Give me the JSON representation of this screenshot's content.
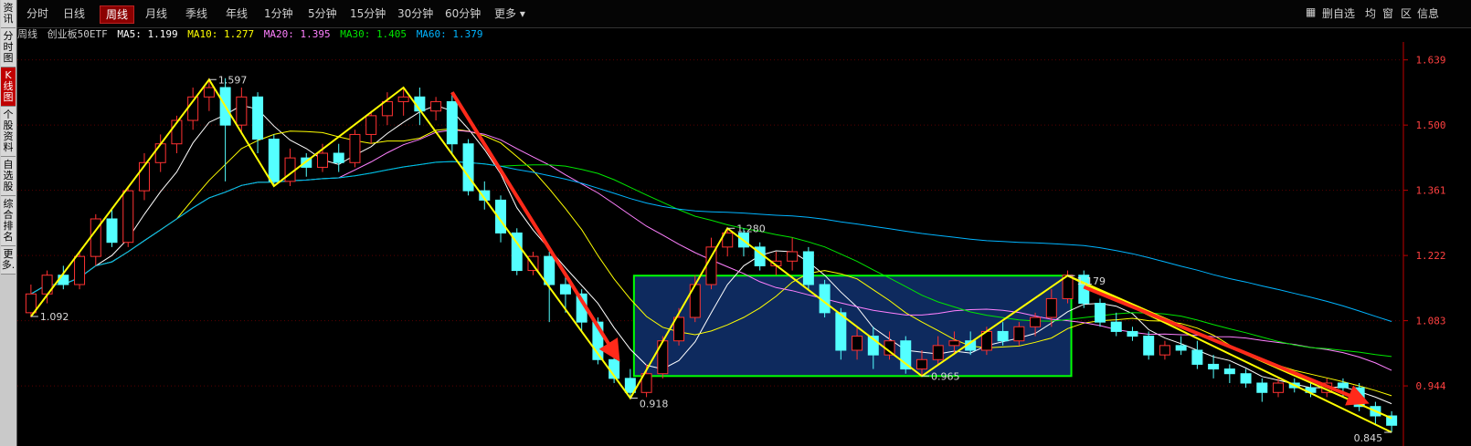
{
  "sidebar": {
    "items": [
      "资讯",
      "分时图",
      "K线图",
      "个股资料",
      "自选股",
      "综合排名",
      "更多."
    ],
    "active_index": 2
  },
  "tabs": [
    "分时",
    "日线",
    "周线",
    "月线",
    "季线",
    "年线",
    "1分钟",
    "5分钟",
    "15分钟",
    "30分钟",
    "60分钟",
    "更多 ▾"
  ],
  "active_tab": 2,
  "tools": [
    "▦",
    "删自选",
    "均",
    "窗",
    "区",
    "信息"
  ],
  "info": {
    "period": "周线",
    "name": "创业板50ETF",
    "ma5": "MA5: 1.199",
    "ma10": "MA10: 1.277",
    "ma20": "MA20: 1.395",
    "ma30": "MA30: 1.405",
    "ma60": "MA60: 1.379"
  },
  "colors": {
    "up": "#ff3232",
    "down": "#54ffff",
    "ma5": "#ffffff",
    "ma10": "#ffff00",
    "ma20": "#ff80ff",
    "ma30": "#00e600",
    "ma60": "#00b4ff",
    "wave": "#ffff00",
    "arrow": "#ff2a1a",
    "box": "#00ff00",
    "boxfill": "#0e2a5e",
    "axis": "#c00000",
    "price_label": "#ff4040"
  },
  "chart_data": {
    "type": "candlestick",
    "ylim": [
      0.845,
      1.65
    ],
    "y_ticks": [
      "1.639",
      "1.500",
      "1.361",
      "1.222",
      "1.083",
      "0.944"
    ],
    "annotations": {
      "peak_labels": [
        {
          "x": 0,
          "y": 1.092,
          "text": "1.092"
        },
        {
          "x": 11,
          "y": 1.597,
          "text": "1.597"
        },
        {
          "x": 37,
          "y": 0.918,
          "text": "0.918"
        },
        {
          "x": 43,
          "y": 1.28,
          "text": "1.280"
        },
        {
          "x": 55,
          "y": 0.965,
          "text": "0.965"
        },
        {
          "x": 64,
          "y": 1.179,
          "text": "1.179"
        },
        {
          "x": 84,
          "y": 0.845,
          "text": "0.845"
        }
      ],
      "consolidation_box": {
        "x0": 37,
        "x1": 64,
        "y0": 0.965,
        "y1": 1.179
      },
      "trend_arrows": [
        {
          "x0": 26,
          "y0": 1.57,
          "x1": 36,
          "y1": 1.015
        },
        {
          "x0": 65,
          "y0": 1.155,
          "x1": 82,
          "y1": 0.915
        }
      ]
    },
    "candles": [
      [
        1.1,
        1.14,
        1.09,
        1.16
      ],
      [
        1.14,
        1.18,
        1.12,
        1.19
      ],
      [
        1.18,
        1.16,
        1.15,
        1.2
      ],
      [
        1.16,
        1.22,
        1.15,
        1.23
      ],
      [
        1.22,
        1.3,
        1.2,
        1.31
      ],
      [
        1.3,
        1.25,
        1.24,
        1.32
      ],
      [
        1.25,
        1.36,
        1.24,
        1.37
      ],
      [
        1.36,
        1.42,
        1.34,
        1.44
      ],
      [
        1.42,
        1.46,
        1.4,
        1.48
      ],
      [
        1.46,
        1.51,
        1.44,
        1.52
      ],
      [
        1.51,
        1.56,
        1.49,
        1.58
      ],
      [
        1.56,
        1.58,
        1.53,
        1.6
      ],
      [
        1.58,
        1.5,
        1.38,
        1.6
      ],
      [
        1.5,
        1.56,
        1.48,
        1.58
      ],
      [
        1.56,
        1.47,
        1.44,
        1.57
      ],
      [
        1.47,
        1.38,
        1.37,
        1.48
      ],
      [
        1.38,
        1.43,
        1.37,
        1.45
      ],
      [
        1.43,
        1.41,
        1.39,
        1.44
      ],
      [
        1.41,
        1.44,
        1.4,
        1.46
      ],
      [
        1.44,
        1.42,
        1.4,
        1.46
      ],
      [
        1.42,
        1.48,
        1.41,
        1.49
      ],
      [
        1.48,
        1.52,
        1.46,
        1.53
      ],
      [
        1.52,
        1.55,
        1.5,
        1.57
      ],
      [
        1.55,
        1.56,
        1.52,
        1.58
      ],
      [
        1.56,
        1.53,
        1.5,
        1.58
      ],
      [
        1.53,
        1.55,
        1.51,
        1.56
      ],
      [
        1.55,
        1.46,
        1.44,
        1.57
      ],
      [
        1.46,
        1.36,
        1.35,
        1.47
      ],
      [
        1.36,
        1.34,
        1.32,
        1.38
      ],
      [
        1.34,
        1.27,
        1.25,
        1.35
      ],
      [
        1.27,
        1.19,
        1.18,
        1.28
      ],
      [
        1.19,
        1.22,
        1.18,
        1.23
      ],
      [
        1.22,
        1.16,
        1.08,
        1.23
      ],
      [
        1.16,
        1.14,
        1.1,
        1.18
      ],
      [
        1.14,
        1.08,
        1.06,
        1.15
      ],
      [
        1.08,
        1.0,
        0.99,
        1.09
      ],
      [
        1.0,
        0.96,
        0.95,
        1.01
      ],
      [
        0.96,
        0.93,
        0.918,
        0.98
      ],
      [
        0.93,
        0.97,
        0.92,
        0.99
      ],
      [
        0.97,
        1.04,
        0.96,
        1.05
      ],
      [
        1.04,
        1.09,
        1.03,
        1.11
      ],
      [
        1.09,
        1.16,
        1.08,
        1.18
      ],
      [
        1.16,
        1.24,
        1.15,
        1.26
      ],
      [
        1.24,
        1.27,
        1.22,
        1.28
      ],
      [
        1.27,
        1.24,
        1.22,
        1.28
      ],
      [
        1.24,
        1.2,
        1.19,
        1.25
      ],
      [
        1.2,
        1.21,
        1.18,
        1.23
      ],
      [
        1.21,
        1.23,
        1.19,
        1.26
      ],
      [
        1.23,
        1.16,
        1.15,
        1.24
      ],
      [
        1.16,
        1.1,
        1.09,
        1.17
      ],
      [
        1.1,
        1.02,
        1.0,
        1.11
      ],
      [
        1.02,
        1.05,
        1.0,
        1.07
      ],
      [
        1.05,
        1.01,
        0.98,
        1.07
      ],
      [
        1.01,
        1.04,
        1.0,
        1.06
      ],
      [
        1.04,
        0.98,
        0.97,
        1.05
      ],
      [
        0.98,
        1.0,
        0.965,
        1.02
      ],
      [
        1.0,
        1.03,
        0.99,
        1.05
      ],
      [
        1.03,
        1.04,
        1.01,
        1.06
      ],
      [
        1.04,
        1.02,
        1.01,
        1.06
      ],
      [
        1.02,
        1.06,
        1.01,
        1.07
      ],
      [
        1.06,
        1.04,
        1.03,
        1.08
      ],
      [
        1.04,
        1.07,
        1.03,
        1.08
      ],
      [
        1.07,
        1.09,
        1.05,
        1.1
      ],
      [
        1.09,
        1.13,
        1.07,
        1.15
      ],
      [
        1.13,
        1.18,
        1.12,
        1.19
      ],
      [
        1.18,
        1.12,
        1.11,
        1.19
      ],
      [
        1.12,
        1.08,
        1.07,
        1.13
      ],
      [
        1.08,
        1.06,
        1.05,
        1.1
      ],
      [
        1.06,
        1.05,
        1.04,
        1.07
      ],
      [
        1.05,
        1.01,
        1.0,
        1.06
      ],
      [
        1.01,
        1.03,
        1.0,
        1.04
      ],
      [
        1.03,
        1.02,
        1.01,
        1.05
      ],
      [
        1.02,
        0.99,
        0.98,
        1.04
      ],
      [
        0.99,
        0.98,
        0.96,
        1.01
      ],
      [
        0.98,
        0.97,
        0.95,
        0.99
      ],
      [
        0.97,
        0.95,
        0.94,
        0.98
      ],
      [
        0.95,
        0.93,
        0.91,
        0.96
      ],
      [
        0.93,
        0.95,
        0.92,
        0.96
      ],
      [
        0.95,
        0.94,
        0.93,
        0.96
      ],
      [
        0.94,
        0.93,
        0.92,
        0.95
      ],
      [
        0.93,
        0.95,
        0.92,
        0.96
      ],
      [
        0.95,
        0.94,
        0.92,
        0.96
      ],
      [
        0.94,
        0.9,
        0.89,
        0.95
      ],
      [
        0.9,
        0.88,
        0.86,
        0.91
      ],
      [
        0.88,
        0.86,
        0.845,
        0.89
      ]
    ],
    "wave_line": [
      {
        "x": 0,
        "y": 1.092
      },
      {
        "x": 11,
        "y": 1.597
      },
      {
        "x": 15,
        "y": 1.37
      },
      {
        "x": 23,
        "y": 1.58
      },
      {
        "x": 37,
        "y": 0.918
      },
      {
        "x": 43,
        "y": 1.28
      },
      {
        "x": 55,
        "y": 0.965
      },
      {
        "x": 64,
        "y": 1.179
      },
      {
        "x": 84,
        "y": 0.845
      }
    ],
    "wave_upper": [
      {
        "x": 64,
        "y": 1.179
      },
      {
        "x": 84,
        "y": 0.875
      }
    ]
  }
}
